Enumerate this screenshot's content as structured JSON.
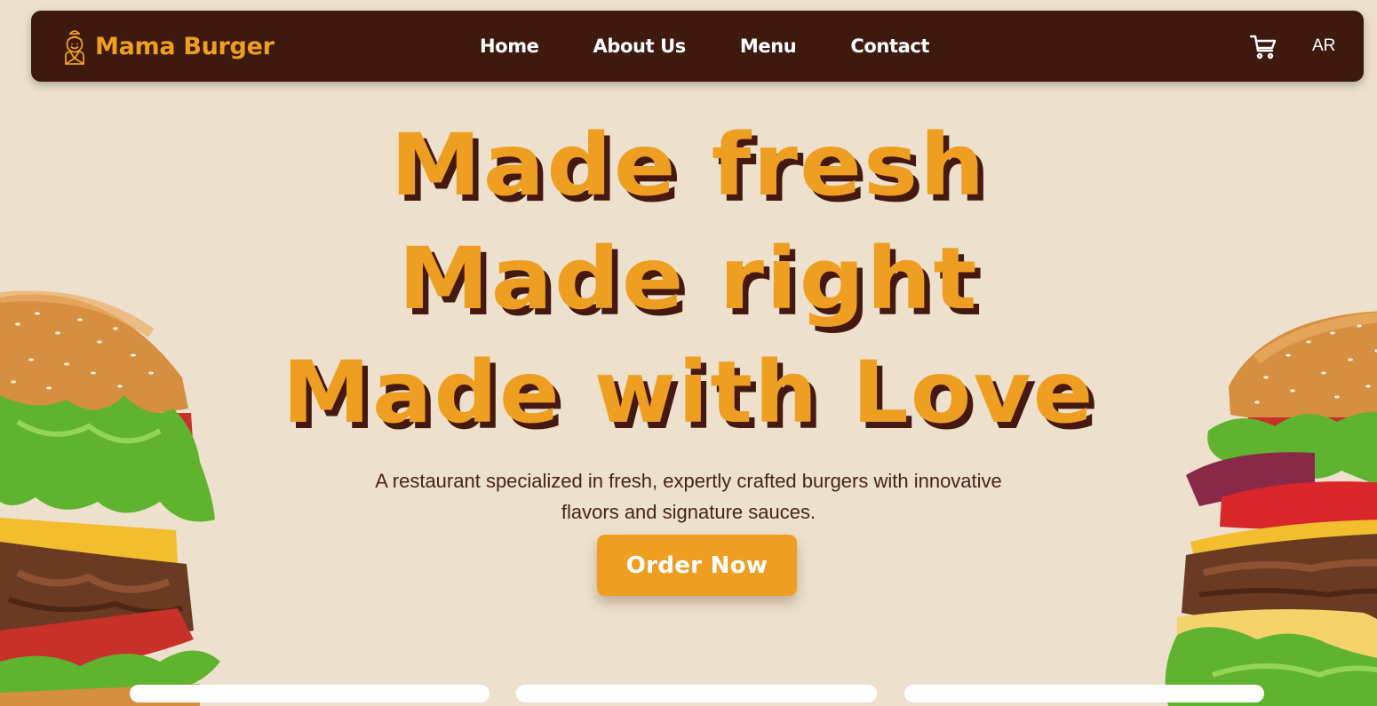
{
  "brand": {
    "name": "Mama Burger",
    "logo_icon": "chef-lady-icon"
  },
  "nav": {
    "items": [
      {
        "label": "Home"
      },
      {
        "label": "About Us"
      },
      {
        "label": "Menu"
      },
      {
        "label": "Contact"
      }
    ],
    "cart_icon": "shopping-cart-icon",
    "language": "AR"
  },
  "hero": {
    "headline": [
      "Made fresh",
      "Made right",
      "Made with Love"
    ],
    "subtitle": "A restaurant specialized in fresh, expertly crafted burgers with innovative flavors and signature sauces.",
    "cta_label": "Order Now"
  },
  "colors": {
    "background": "#ede1cd",
    "navbar": "#3e1a0e",
    "accent": "#ee9f21",
    "headline_shadow": "#45190f",
    "body_text": "#43231b"
  }
}
